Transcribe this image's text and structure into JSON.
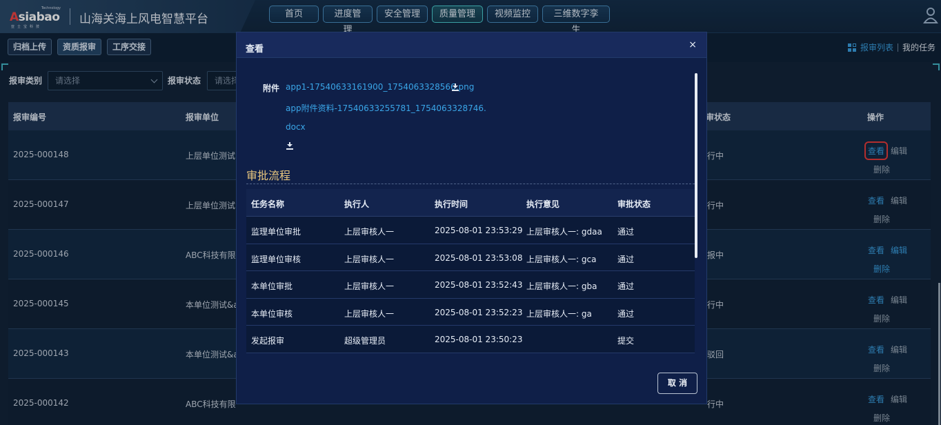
{
  "header": {
    "logo": {
      "tech": "Technology",
      "word": "Asiabao",
      "cn": "亚士宝科技"
    },
    "title": "山海关海上风电智慧平台",
    "nav": [
      "首页",
      "进度管理",
      "安全管理",
      "质量管理",
      "视频监控",
      "三维数字孪生"
    ],
    "active_nav": "质量管理",
    "icons": {
      "user": "avatar-icon"
    }
  },
  "subtabs": [
    "归档上传",
    "资质报审",
    "工序交接"
  ],
  "active_subtab": "资质报审",
  "right_links": {
    "list": "报审列表",
    "tasks": "我的任务"
  },
  "filters": {
    "category_label": "报审类别",
    "category_placeholder": "请选择",
    "status_label": "报审状态",
    "status_placeholder": "请选择"
  },
  "table": {
    "headers": {
      "no": "报审编号",
      "unit": "报审单位",
      "status": "审状态",
      "ops": "操作"
    },
    "ops": {
      "view": "查看",
      "edit": "编辑",
      "delete": "删除"
    },
    "rows": [
      {
        "no": "2025-000148",
        "unit": "上层单位测试",
        "status": "行中"
      },
      {
        "no": "2025-000147",
        "unit": "上层单位测试",
        "status": "行中"
      },
      {
        "no": "2025-000146",
        "unit": "ABC科技有限",
        "status": "报中"
      },
      {
        "no": "2025-000145",
        "unit": "本单位测试&a",
        "status": "行中"
      },
      {
        "no": "2025-000143",
        "unit": "本单位测试&a",
        "status": "驳回"
      },
      {
        "no": "2025-000142",
        "unit": "ABC科技有限",
        "status": "行中"
      }
    ]
  },
  "modal": {
    "title": "查看",
    "close": "×",
    "attachment_label": "附件",
    "attachments": [
      "app1-17540633161900_1754063328566.png",
      "app附件资料-17540633255781_1754063328746.",
      "docx"
    ],
    "flow_title": "审批流程",
    "flow_headers": [
      "任务名称",
      "执行人",
      "执行时间",
      "执行意见",
      "审批状态"
    ],
    "flow_rows": [
      [
        "监理单位审批",
        "上层审核人一",
        "2025-08-01 23:53:29",
        "上层审核人一: gdaa",
        "通过"
      ],
      [
        "监理单位审核",
        "上层审核人一",
        "2025-08-01 23:53:08",
        "上层审核人一: gca",
        "通过"
      ],
      [
        "本单位审批",
        "上层审核人一",
        "2025-08-01 23:52:43",
        "上层审核人一: gba",
        "通过"
      ],
      [
        "本单位审核",
        "上层审核人一",
        "2025-08-01 23:52:23",
        "上层审核人一: ga",
        "通过"
      ],
      [
        "发起报审",
        "超级管理员",
        "2025-08-01 23:50:23",
        "",
        "提交"
      ]
    ],
    "cancel": "取 消"
  },
  "colors": {
    "accent": "#3a9fe0",
    "flow_title": "#e9c77e",
    "highlight": "#e63b3b"
  }
}
